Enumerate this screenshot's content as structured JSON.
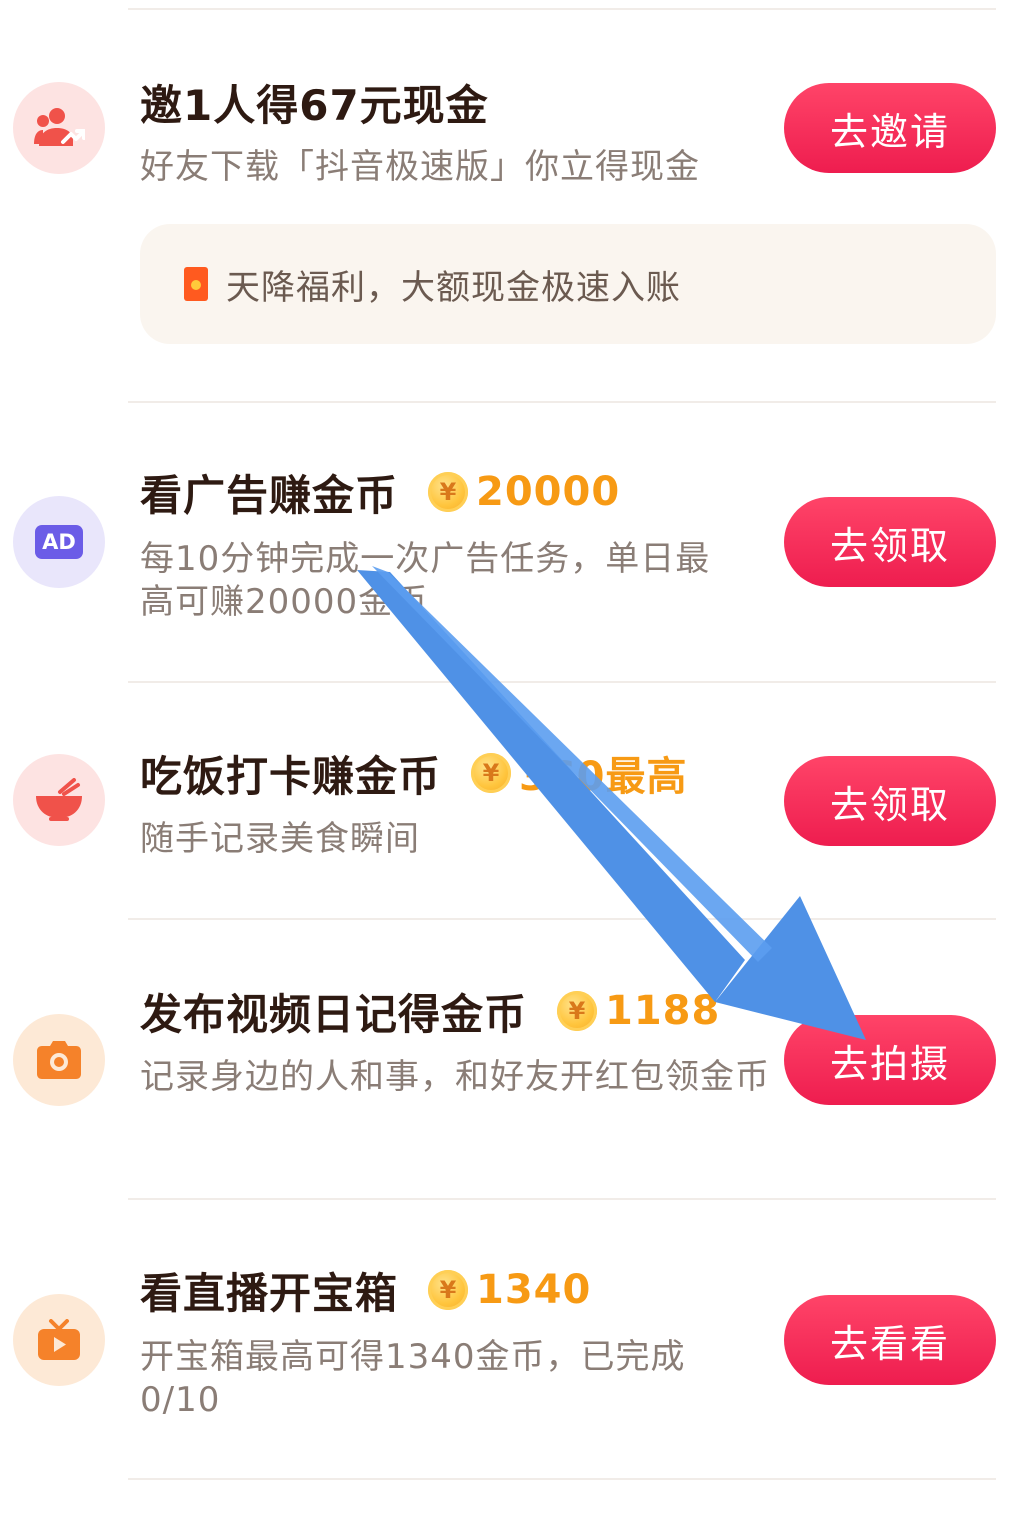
{
  "tasks": [
    {
      "title": "邀1人得67元现金",
      "description": "好友下载「抖音极速版」你立得现金",
      "button": "去邀请",
      "icon": "invite-friends-icon",
      "icon_bg": "#fde3e2",
      "icon_color": "#f0524a",
      "banner": "天降福利，大额现金极速入账"
    },
    {
      "title": "看广告赚金币",
      "reward": "20000",
      "coin": "¥",
      "description": "每10分钟完成一次广告任务，单日最高可赚20000金币",
      "button": "去领取",
      "icon": "ad-icon",
      "icon_label": "AD",
      "icon_bg": "#e9e6fb",
      "icon_color": "#6b5ce7"
    },
    {
      "title": "吃饭打卡赚金币",
      "reward": "360最高",
      "coin": "¥",
      "description": "随手记录美食瞬间",
      "button": "去领取",
      "icon": "food-bowl-icon",
      "icon_bg": "#fde3e2",
      "icon_color": "#f0524a"
    },
    {
      "title": "发布视频日记得金币",
      "reward": "1188",
      "coin": "¥",
      "description": "记录身边的人和事，和好友开红包领金币",
      "button": "去拍摄",
      "icon": "camera-icon",
      "icon_bg": "#fde9d6",
      "icon_color": "#f5822a"
    },
    {
      "title": "看直播开宝箱",
      "reward": "1340",
      "coin": "¥",
      "description": "开宝箱最高可得1340金币，已完成0/10",
      "button": "去看看",
      "icon": "live-tv-icon",
      "icon_bg": "#fde9d6",
      "icon_color": "#f5822a"
    }
  ],
  "colors": {
    "button": "#f5284f",
    "reward": "#f79a14",
    "title": "#2e1a12",
    "description": "#8a7d76",
    "arrow": "#4a90e2"
  },
  "overlay": {
    "arrow-icon": "arrow-pointing-down-right"
  }
}
